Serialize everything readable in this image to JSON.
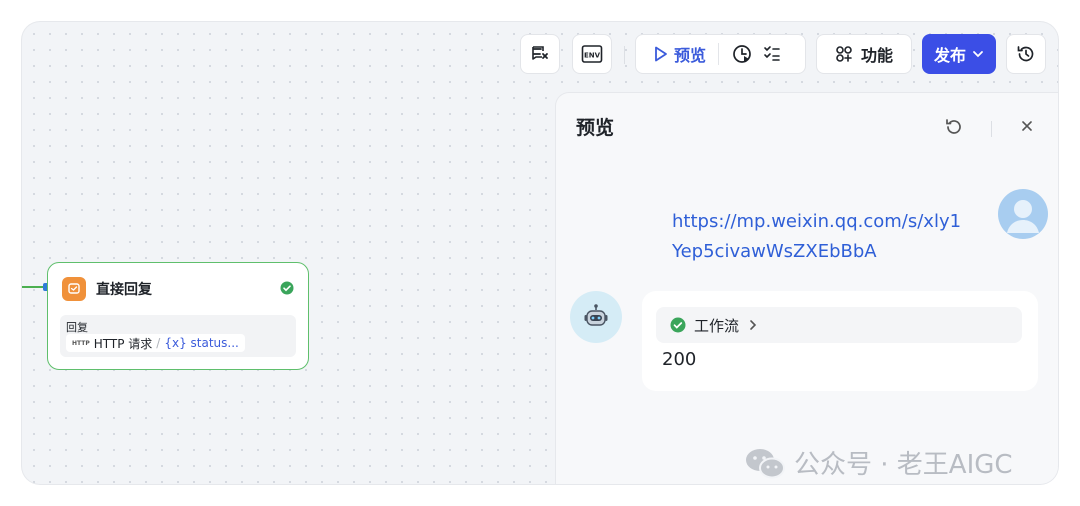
{
  "toolbar": {
    "run_label": "预览",
    "features_label": "功能",
    "publish_label": "发布"
  },
  "node": {
    "title": "直接回复",
    "section_label": "回复",
    "http_mini": "HTTP",
    "source_label": "HTTP 请求",
    "separator": "/",
    "variable_label": "{x} status..."
  },
  "preview": {
    "title": "预览",
    "user_message": "https://mp.weixin.qq.com/s/xly1Yep5civawWsZXEbBbA",
    "workflow_label": "工作流",
    "result": "200"
  },
  "watermark": {
    "text": "公众号 · 老王AIGC"
  },
  "colors": {
    "accent": "#3b4ee6",
    "success": "#3aa55b",
    "link": "#2f5fd7",
    "node_icon": "#f0913a"
  },
  "icons": [
    "clear-checklist-icon",
    "env-icon",
    "play-icon",
    "history-run-icon",
    "checklist-icon",
    "features-icon",
    "chevron-down-icon",
    "version-history-icon",
    "reply-icon",
    "check-circle-icon",
    "refresh-icon",
    "close-icon",
    "user-avatar-icon",
    "robot-icon",
    "chevron-right-icon",
    "wechat-icon"
  ]
}
